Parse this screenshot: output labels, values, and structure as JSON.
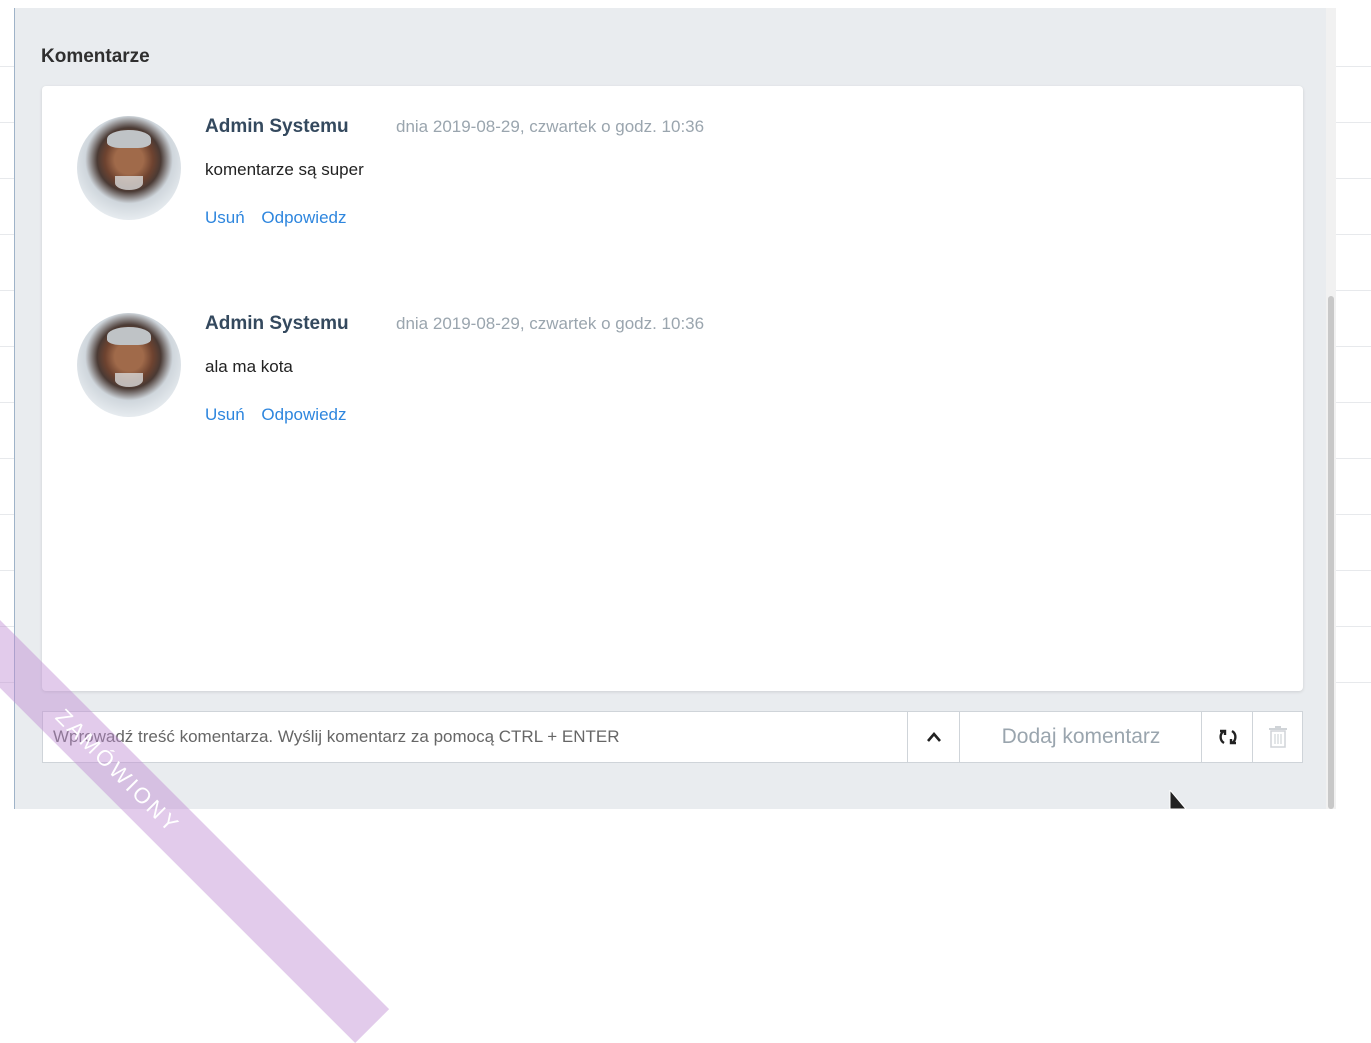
{
  "section": {
    "title": "Komentarze"
  },
  "comments": [
    {
      "author": "Admin Systemu",
      "date": "dnia 2019-08-29, czwartek o godz. 10:36",
      "text": "komentarze są super",
      "delete_label": "Usuń",
      "reply_label": "Odpowiedz"
    },
    {
      "author": "Admin Systemu",
      "date": "dnia 2019-08-29, czwartek o godz. 10:36",
      "text": "ala ma kota",
      "delete_label": "Usuń",
      "reply_label": "Odpowiedz"
    }
  ],
  "input": {
    "placeholder": "Wprowadź treść komentarza. Wyślij komentarz za pomocą CTRL + ENTER",
    "add_label": "Dodaj komentarz"
  },
  "watermark": {
    "text": "ZAMÓWIONY"
  },
  "colors": {
    "link": "#2e86de",
    "author": "#34495e",
    "muted": "#9aa5ae",
    "panel_bg": "#e9ecef"
  },
  "icons": {
    "expand": "chevron-up-icon",
    "refresh": "refresh-icon",
    "delete": "trash-icon"
  }
}
